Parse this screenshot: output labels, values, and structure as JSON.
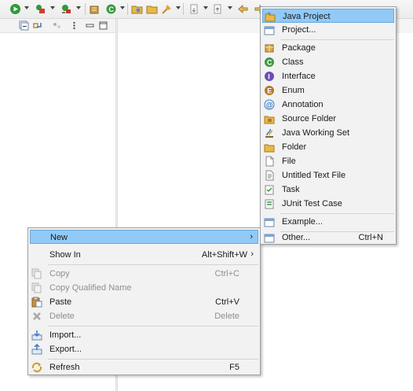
{
  "toolbar": {
    "icons": [
      "debug-icon",
      "run-icon",
      "external-tools-icon",
      "new-java-project-icon",
      "new-package-icon",
      "new-class-icon",
      "open-type-icon",
      "open-folder-icon",
      "search-icon",
      "annotation-next-icon",
      "annotation-prev-icon",
      "back-icon",
      "forward-icon"
    ]
  },
  "view_toolbar": {
    "icons": [
      "collapse-all-icon",
      "link-with-editor-icon",
      "filters-icon",
      "view-menu-icon",
      "minimize-icon",
      "maximize-icon"
    ]
  },
  "context_menu": {
    "items": [
      {
        "label": "New",
        "shortcut": "",
        "submenu": true,
        "selected": true,
        "enabled": true,
        "icon": ""
      },
      {
        "label": "Show In",
        "shortcut": "Alt+Shift+W",
        "submenu": true,
        "enabled": true,
        "icon": ""
      },
      {
        "label": "Copy",
        "shortcut": "Ctrl+C",
        "enabled": false,
        "icon": "copy-icon"
      },
      {
        "label": "Copy Qualified Name",
        "shortcut": "",
        "enabled": false,
        "icon": "copy-qualified-name-icon"
      },
      {
        "label": "Paste",
        "shortcut": "Ctrl+V",
        "enabled": true,
        "icon": "paste-icon"
      },
      {
        "label": "Delete",
        "shortcut": "Delete",
        "enabled": false,
        "icon": "delete-icon"
      },
      {
        "label": "Import...",
        "shortcut": "",
        "enabled": true,
        "icon": "import-icon"
      },
      {
        "label": "Export...",
        "shortcut": "",
        "enabled": true,
        "icon": "export-icon"
      },
      {
        "label": "Refresh",
        "shortcut": "F5",
        "enabled": true,
        "icon": "refresh-icon"
      }
    ]
  },
  "new_submenu": {
    "items": [
      {
        "label": "Java Project",
        "shortcut": "",
        "selected": true,
        "icon": "java-project-icon"
      },
      {
        "label": "Project...",
        "shortcut": "",
        "icon": "project-icon"
      },
      {
        "label": "Package",
        "shortcut": "",
        "icon": "package-icon"
      },
      {
        "label": "Class",
        "shortcut": "",
        "icon": "class-icon"
      },
      {
        "label": "Interface",
        "shortcut": "",
        "icon": "interface-icon"
      },
      {
        "label": "Enum",
        "shortcut": "",
        "icon": "enum-icon"
      },
      {
        "label": "Annotation",
        "shortcut": "",
        "icon": "annotation-icon"
      },
      {
        "label": "Source Folder",
        "shortcut": "",
        "icon": "source-folder-icon"
      },
      {
        "label": "Java Working Set",
        "shortcut": "",
        "icon": "java-working-set-icon"
      },
      {
        "label": "Folder",
        "shortcut": "",
        "icon": "folder-icon"
      },
      {
        "label": "File",
        "shortcut": "",
        "icon": "file-icon"
      },
      {
        "label": "Untitled Text File",
        "shortcut": "",
        "icon": "untitled-text-file-icon"
      },
      {
        "label": "Task",
        "shortcut": "",
        "icon": "task-icon"
      },
      {
        "label": "JUnit Test Case",
        "shortcut": "",
        "icon": "junit-test-case-icon"
      },
      {
        "label": "Example...",
        "shortcut": "",
        "icon": "example-icon"
      },
      {
        "label": "Other...",
        "shortcut": "Ctrl+N",
        "icon": "other-icon"
      }
    ]
  },
  "colors": {
    "selection": "#91c9f7",
    "selection_border": "#6aa7da",
    "menu_background": "#f2f2f2",
    "disabled_text": "#8f8f8f"
  }
}
